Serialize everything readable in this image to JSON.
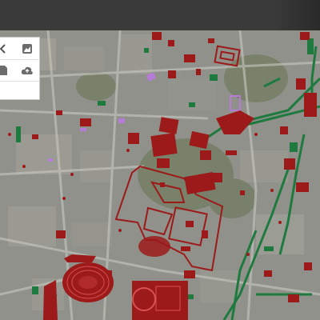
{
  "map": {
    "colors": {
      "basemap": "#8a8d86",
      "buildings": "#9c1a1a",
      "roads": "#1f7a3f",
      "accent": "#b57bd6"
    }
  },
  "toolbar": {
    "icons": [
      "chevron-left-icon",
      "image-layer-icon",
      "document-icon",
      "cloud-icon"
    ]
  }
}
